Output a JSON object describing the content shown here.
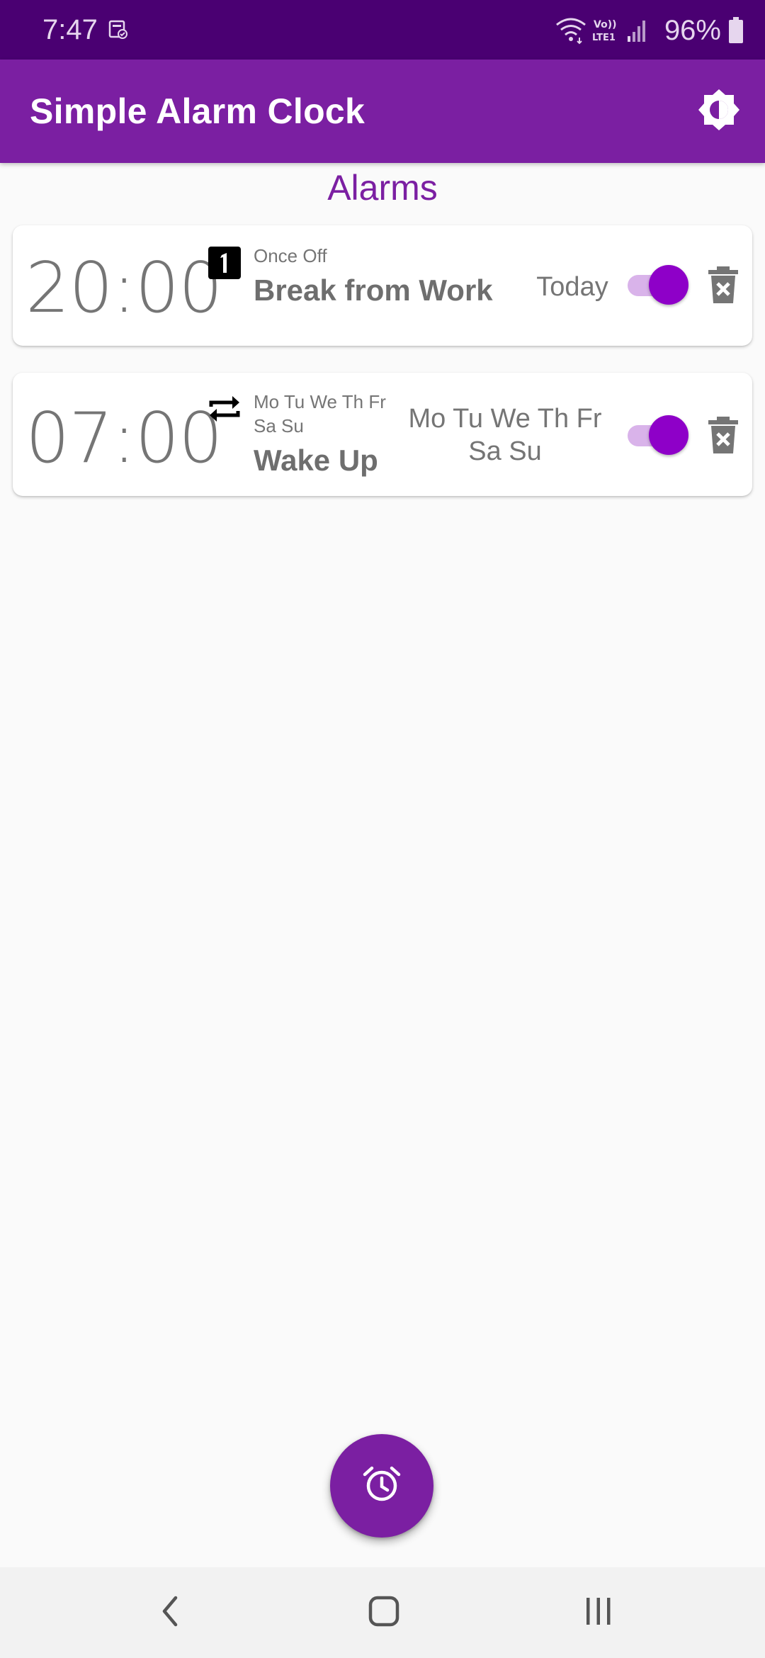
{
  "status_bar": {
    "time": "7:47",
    "battery": "96%",
    "icons": [
      "notification-icon",
      "wifi-icon",
      "volte-icon",
      "signal-icon",
      "battery-icon"
    ]
  },
  "app_bar": {
    "title": "Simple Alarm Clock",
    "theme_icon": "brightness-icon"
  },
  "section": {
    "title": "Alarms"
  },
  "alarms": [
    {
      "time_hh": "20",
      "time_mm": "00",
      "type_icon": "one-icon",
      "repeat": "Once Off",
      "label": "Break from Work",
      "days": "Today",
      "enabled": true
    },
    {
      "time_hh": "07",
      "time_mm": "00",
      "type_icon": "repeat-icon",
      "repeat": "Mo Tu We Th Fr Sa Su",
      "label": "Wake Up",
      "days": "Mo Tu We Th Fr Sa Su",
      "enabled": true
    }
  ],
  "fab": {
    "icon": "alarm-clock-icon"
  },
  "nav_bar": {
    "icons": [
      "back-icon",
      "home-icon",
      "recents-icon"
    ]
  },
  "colors": {
    "status_bar": "#4a0072",
    "primary": "#7b1fa2",
    "toggle_thumb": "#8e00c8",
    "toggle_track": "#d9b3ea",
    "background": "#fafafa"
  }
}
